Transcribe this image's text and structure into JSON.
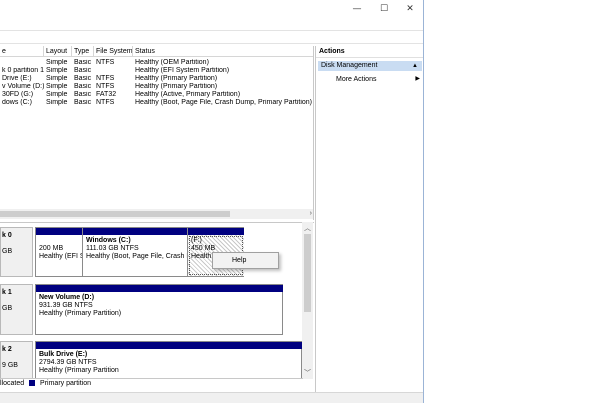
{
  "window": {
    "minimize_glyph": "—",
    "maximize_glyph": "☐",
    "close_glyph": "✕"
  },
  "volume_list": {
    "columns": [
      "e",
      "Layout",
      "Type",
      "File System",
      "Status"
    ],
    "rows": [
      {
        "volume": "",
        "layout": "Simple",
        "type": "Basic",
        "fs": "NTFS",
        "status": "Healthy (OEM Partition)"
      },
      {
        "volume": "k 0 partition 1)",
        "layout": "Simple",
        "type": "Basic",
        "fs": "",
        "status": "Healthy (EFI System Partition)"
      },
      {
        "volume": "Drive (E:)",
        "layout": "Simple",
        "type": "Basic",
        "fs": "NTFS",
        "status": "Healthy (Primary Partition)"
      },
      {
        "volume": "v Volume (D:)",
        "layout": "Simple",
        "type": "Basic",
        "fs": "NTFS",
        "status": "Healthy (Primary Partition)"
      },
      {
        "volume": "30FD (G:)",
        "layout": "Simple",
        "type": "Basic",
        "fs": "FAT32",
        "status": "Healthy (Active, Primary Partition)"
      },
      {
        "volume": "dows (C:)",
        "layout": "Simple",
        "type": "Basic",
        "fs": "NTFS",
        "status": "Healthy (Boot, Page File, Crash Dump, Primary Partition)"
      }
    ]
  },
  "disks": [
    {
      "name": "k 0",
      "size": "GB",
      "partitions": [
        {
          "title": "",
          "size": "200 MB",
          "status": "Healthy (EFI S"
        },
        {
          "title": "Windows  (C:)",
          "size": "111.03 GB NTFS",
          "status": "Healthy (Boot, Page File, Crash D"
        },
        {
          "title": "(F:)",
          "size": "450 MB",
          "status": "Health"
        }
      ]
    },
    {
      "name": "k 1",
      "size": "GB",
      "partitions": [
        {
          "title": "New Volume  (D:)",
          "size": "931.39 GB NTFS",
          "status": "Healthy (Primary Partition)"
        }
      ]
    },
    {
      "name": "k 2",
      "size": "9 GB",
      "partitions": [
        {
          "title": "Bulk Drive  (E:)",
          "size": "2794.39 GB NTFS",
          "status": "Healthy (Primary Partition"
        }
      ]
    }
  ],
  "legend": {
    "unallocated": "llocated",
    "primary": "Primary partition",
    "unallocated_color": "#000000",
    "primary_color": "#000080"
  },
  "context_menu": {
    "items": [
      "Help"
    ]
  },
  "actions": {
    "header": "Actions",
    "section": "Disk Management",
    "item": "More Actions"
  },
  "colors": {
    "partition_bar": "#000080",
    "selection": "#c9dcf2"
  }
}
